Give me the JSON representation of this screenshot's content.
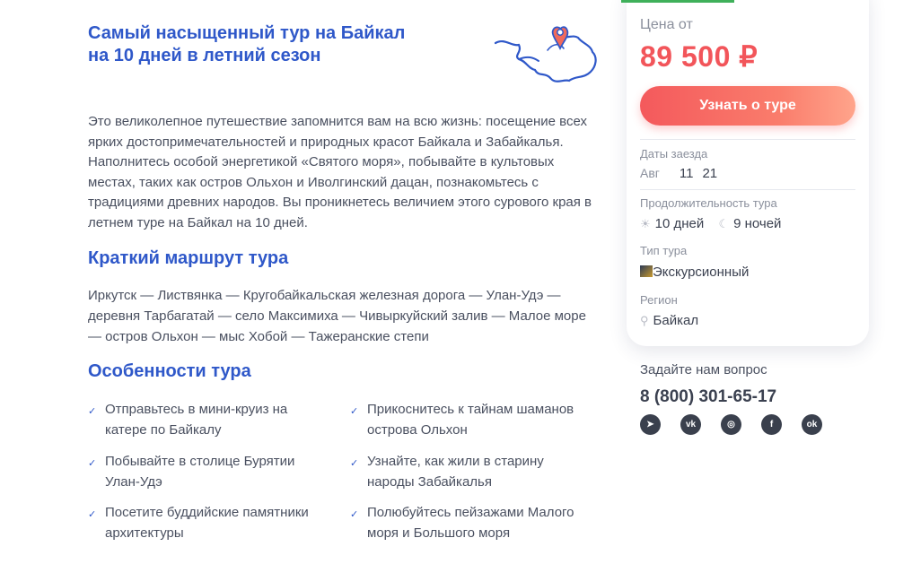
{
  "tour": {
    "title_line1": "Самый насыщенный тур на Байкал",
    "title_line2": "на 10 дней в летний сезон",
    "intro": "Это великолепное путешествие запомнится вам на всю жизнь: посещение всех ярких достопримечательностей и природных красот Байкала и Забайкалья. Наполнитесь особой энергетикой «Святого моря», побывайте в культовых местах, таких как остров Ольхон и Иволгинский дацан, познакомьтесь с традициями древних народов. Вы проникнетесь величием этого сурового края в летнем туре на Байкал на 10 дней.",
    "route_heading": "Краткий маршрут тура",
    "route": "Иркутск — Листвянка — Кругобайкальская железная дорога — Улан-Удэ — деревня Тарбагатай — село Максимиха — Чивыркуйский залив — Малое море — остров Ольхон — мыс Хобой — Тажеранские степи",
    "features_heading": "Особенности тура",
    "features": [
      "Отправьтесь в мини-круиз на катере по Байкалу",
      "Прикоснитесь к тайнам шаманов острова Ольхон",
      "Побывайте в столице Бурятии Улан-Удэ",
      "Узнайте, как жили в старину народы Забайкалья",
      "Посетите буддийские памятники архитектуры",
      "Полюбуйтесь пейзажами Малого моря и Большого моря"
    ]
  },
  "card": {
    "price_label": "Цена от",
    "price": "89 500 ₽",
    "cta": "Узнать о туре",
    "dates_label": "Даты заезда",
    "dates_month": "Авг",
    "dates_day1": "11",
    "dates_day2": "21",
    "duration_label": "Продолжительность тура",
    "duration_days": "10 дней",
    "duration_nights": "9 ночей",
    "type_label": "Тип тура",
    "type_value": "Экскурсионный",
    "region_label": "Регион",
    "region_value": "Байкал"
  },
  "contact": {
    "ask": "Задайте нам вопрос",
    "phone": "8 (800) 301-65-17",
    "socials": [
      "telegram-icon",
      "vk-icon",
      "instagram-icon",
      "facebook-icon",
      "odnoklassniki-icon"
    ]
  },
  "colors": {
    "accent_blue": "#2f58c9",
    "price_red": "#f2555a",
    "green_bar": "#3fb05a"
  }
}
